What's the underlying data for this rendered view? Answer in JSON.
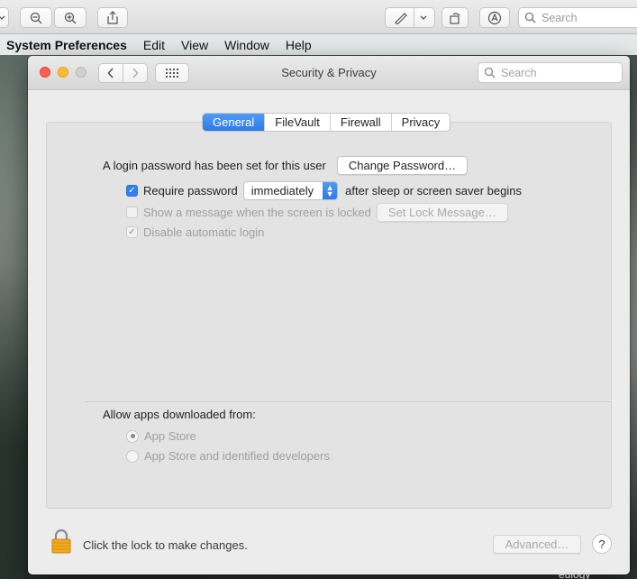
{
  "menubar": {
    "app_name": "System Preferences",
    "items": [
      "Edit",
      "View",
      "Window",
      "Help"
    ]
  },
  "preview_toolbar": {
    "search_placeholder": "Search"
  },
  "window": {
    "title": "Security & Privacy",
    "search_placeholder": "Search",
    "tabs": [
      {
        "label": "General",
        "active": true
      },
      {
        "label": "FileVault",
        "active": false
      },
      {
        "label": "Firewall",
        "active": false
      },
      {
        "label": "Privacy",
        "active": false
      }
    ],
    "general": {
      "login_password_text": "A login password has been set for this user",
      "change_password_button": "Change Password…",
      "require_password_label": "Require password",
      "require_password_checked": true,
      "require_password_delay": "immediately",
      "require_password_suffix": "after sleep or screen saver begins",
      "show_message_label": "Show a message when the screen is locked",
      "show_message_checked": false,
      "set_lock_message_button": "Set Lock Message…",
      "disable_auto_login_label": "Disable automatic login",
      "disable_auto_login_checked": true,
      "allow_apps_heading": "Allow apps downloaded from:",
      "allow_apps_options": [
        {
          "label": "App Store",
          "selected": true
        },
        {
          "label": "App Store and identified developers",
          "selected": false
        }
      ]
    },
    "footer": {
      "lock_text": "Click the lock to make changes.",
      "advanced_button": "Advanced…",
      "help_button": "?"
    }
  },
  "desktop": {
    "label": "eulogy"
  },
  "colors": {
    "accent": "#2d79e6",
    "close": "#fd5f57",
    "minimize": "#febc2e",
    "lock": "#f0a81f"
  }
}
